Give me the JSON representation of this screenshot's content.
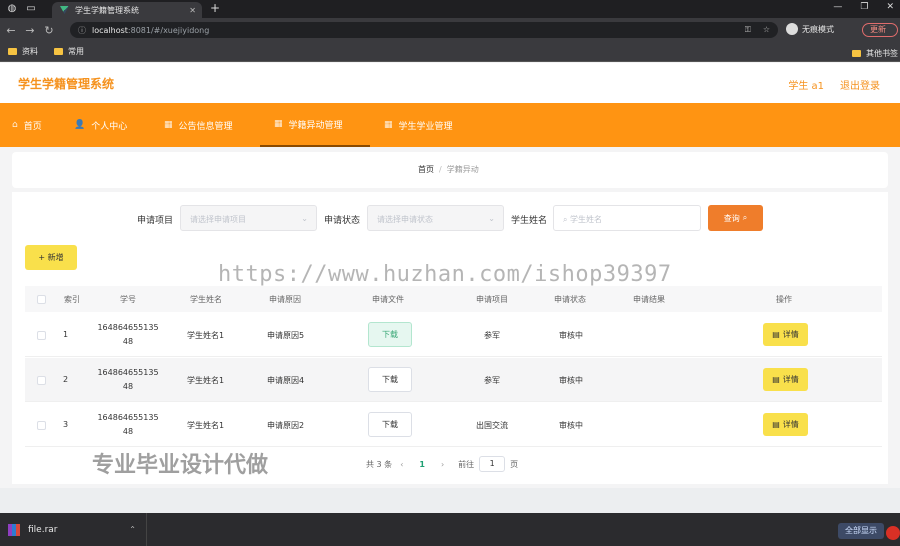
{
  "browser": {
    "tab_title": "学生学籍管理系统",
    "url_host": "localhost",
    "url_path": ":8081/#/xuejiyidong",
    "incognito_label": "无痕模式",
    "update_label": "更新",
    "bookmarks": [
      "资料",
      "常用"
    ],
    "bookmarks_right": "其他书签"
  },
  "app": {
    "title": "学生学籍管理系统",
    "user": "学生 a1",
    "logout": "退出登录"
  },
  "nav": [
    {
      "label": "首页",
      "icon": "home-icon"
    },
    {
      "label": "个人中心",
      "icon": "user-icon"
    },
    {
      "label": "公告信息管理",
      "icon": "grid-icon"
    },
    {
      "label": "学籍异动管理",
      "icon": "grid-icon",
      "active": true
    },
    {
      "label": "学生学业管理",
      "icon": "grid-icon"
    }
  ],
  "breadcrumb": {
    "home": "首页",
    "sep": "/",
    "current": "学籍异动"
  },
  "search": {
    "project_label": "申请项目",
    "project_placeholder": "请选择申请项目",
    "status_label": "申请状态",
    "status_placeholder": "请选择申请状态",
    "name_label": "学生姓名",
    "name_placeholder": "学生姓名",
    "query_button": "查询"
  },
  "add_button": "+ 新增",
  "table": {
    "headers": [
      "索引",
      "学号",
      "学生姓名",
      "申请原因",
      "申请文件",
      "申请项目",
      "申请状态",
      "申请结果",
      "操作"
    ],
    "rows": [
      {
        "index": "1",
        "student_no_1": "164864655135",
        "student_no_2": "48",
        "name": "学生姓名1",
        "reason": "申请原因5",
        "file": "下载",
        "project": "参军",
        "status": "审核中",
        "result": "",
        "action": "详情"
      },
      {
        "index": "2",
        "student_no_1": "164864655135",
        "student_no_2": "48",
        "name": "学生姓名1",
        "reason": "申请原因4",
        "file": "下载",
        "project": "参军",
        "status": "审核中",
        "result": "",
        "action": "详情"
      },
      {
        "index": "3",
        "student_no_1": "164864655135",
        "student_no_2": "48",
        "name": "学生姓名1",
        "reason": "申请原因2",
        "file": "下载",
        "project": "出国交流",
        "status": "审核中",
        "result": "",
        "action": "详情"
      }
    ]
  },
  "pagination": {
    "total": "共 3 条",
    "prev": "‹",
    "current": "1",
    "next": "›",
    "goto_prefix": "前往",
    "goto_value": "1",
    "goto_suffix": "页"
  },
  "watermarks": {
    "url": "https://www.huzhan.com/ishop39397",
    "text": "专业毕业设计代做"
  },
  "download_bar": {
    "file": "file.rar",
    "show_all": "全部显示"
  },
  "colors": {
    "accent": "#ff9412",
    "title": "#f5921e",
    "yellow_button": "#f9e04b",
    "query_button": "#ef7d2b"
  }
}
